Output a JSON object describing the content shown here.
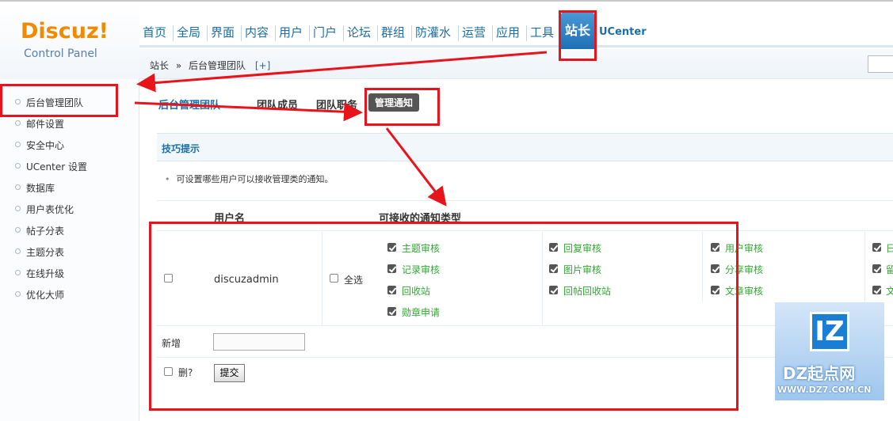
{
  "logo": {
    "brand": "Discuz!",
    "sub": "Control Panel"
  },
  "topnav": {
    "items": [
      "首页",
      "全局",
      "界面",
      "内容",
      "用户",
      "门户",
      "论坛",
      "群组",
      "防灌水",
      "运营",
      "应用",
      "工具"
    ],
    "active": "站长",
    "ucenter": "UCenter"
  },
  "breadcrumb": {
    "root": "站长",
    "sep": "»",
    "current": "后台管理团队",
    "plus": "[+]"
  },
  "sidebar": {
    "items": [
      "后台管理团队",
      "邮件设置",
      "安全中心",
      "UCenter 设置",
      "数据库",
      "用户表优化",
      "帖子分表",
      "主题分表",
      "在线升级",
      "优化大师"
    ]
  },
  "tabs": [
    "后台管理团队",
    "团队成员",
    "团队职务",
    "管理通知"
  ],
  "tips": {
    "title": "技巧提示",
    "line": "可设置哪些用户可以接收管理类的通知。",
    "bullet": "•"
  },
  "table": {
    "col_user": "用户名",
    "col_types": "可接收的通知类型",
    "username": "discuzadmin",
    "select_all": "全选",
    "types_col1": [
      "主题审核",
      "记录审核",
      "回收站",
      "勋章申请"
    ],
    "types_col2": [
      "回复审核",
      "图片审核",
      "回帖回收站"
    ],
    "types_col3": [
      "用户审核",
      "分享审核",
      "文章审核"
    ],
    "types_col4": [
      "日",
      "留",
      "文"
    ],
    "add_label": "新增",
    "delete_label": "删?",
    "submit": "提交"
  },
  "watermark": {
    "logo": "IZ",
    "name": "DZ起点网",
    "url": "WWW.DZ7.COM.CN"
  },
  "colors": {
    "accent": "#1b6ea8",
    "active_tab": "#1d6fb3",
    "annotation": "#e8141c",
    "type_text": "#2fa82f"
  }
}
